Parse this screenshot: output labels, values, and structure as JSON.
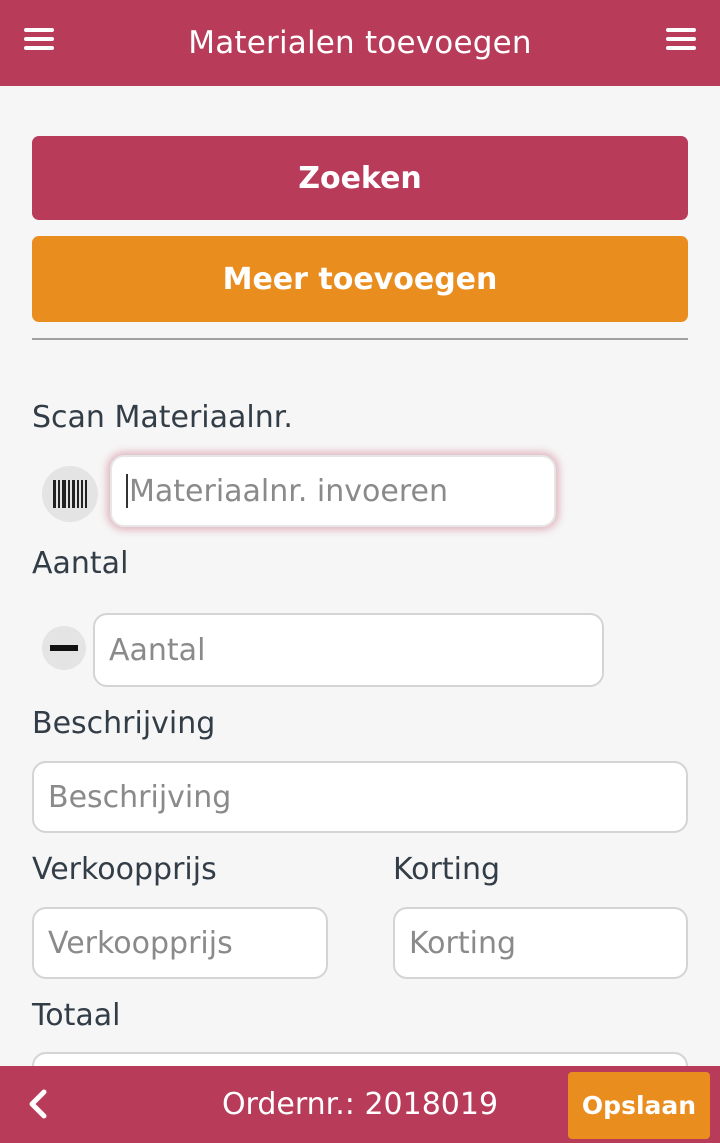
{
  "header": {
    "title": "Materialen toevoegen",
    "left_menu_icon": "hamburger-menu-icon",
    "right_menu_icon": "hamburger-menu-icon"
  },
  "actions": {
    "search_label": "Zoeken",
    "add_more_label": "Meer toevoegen"
  },
  "form": {
    "scan": {
      "label": "Scan Materiaalnr.",
      "placeholder": "Materiaalnr. invoeren",
      "value": "",
      "icon": "barcode-icon"
    },
    "quantity": {
      "label": "Aantal",
      "placeholder": "Aantal",
      "value": "",
      "icon": "minus-icon"
    },
    "description": {
      "label": "Beschrijving",
      "placeholder": "Beschrijving",
      "value": ""
    },
    "price": {
      "label": "Verkoopprijs",
      "placeholder": "Verkoopprijs",
      "value": ""
    },
    "discount": {
      "label": "Korting",
      "placeholder": "Korting",
      "value": ""
    },
    "total": {
      "label": "Totaal",
      "value": ""
    }
  },
  "footer": {
    "order_text": "Ordernr.: 2018019",
    "save_label": "Opslaan",
    "back_icon": "chevron-left-icon"
  },
  "colors": {
    "primary": "#b83b5a",
    "accent": "#ea8d1f",
    "background": "#f6f6f6",
    "text": "#333d47"
  }
}
